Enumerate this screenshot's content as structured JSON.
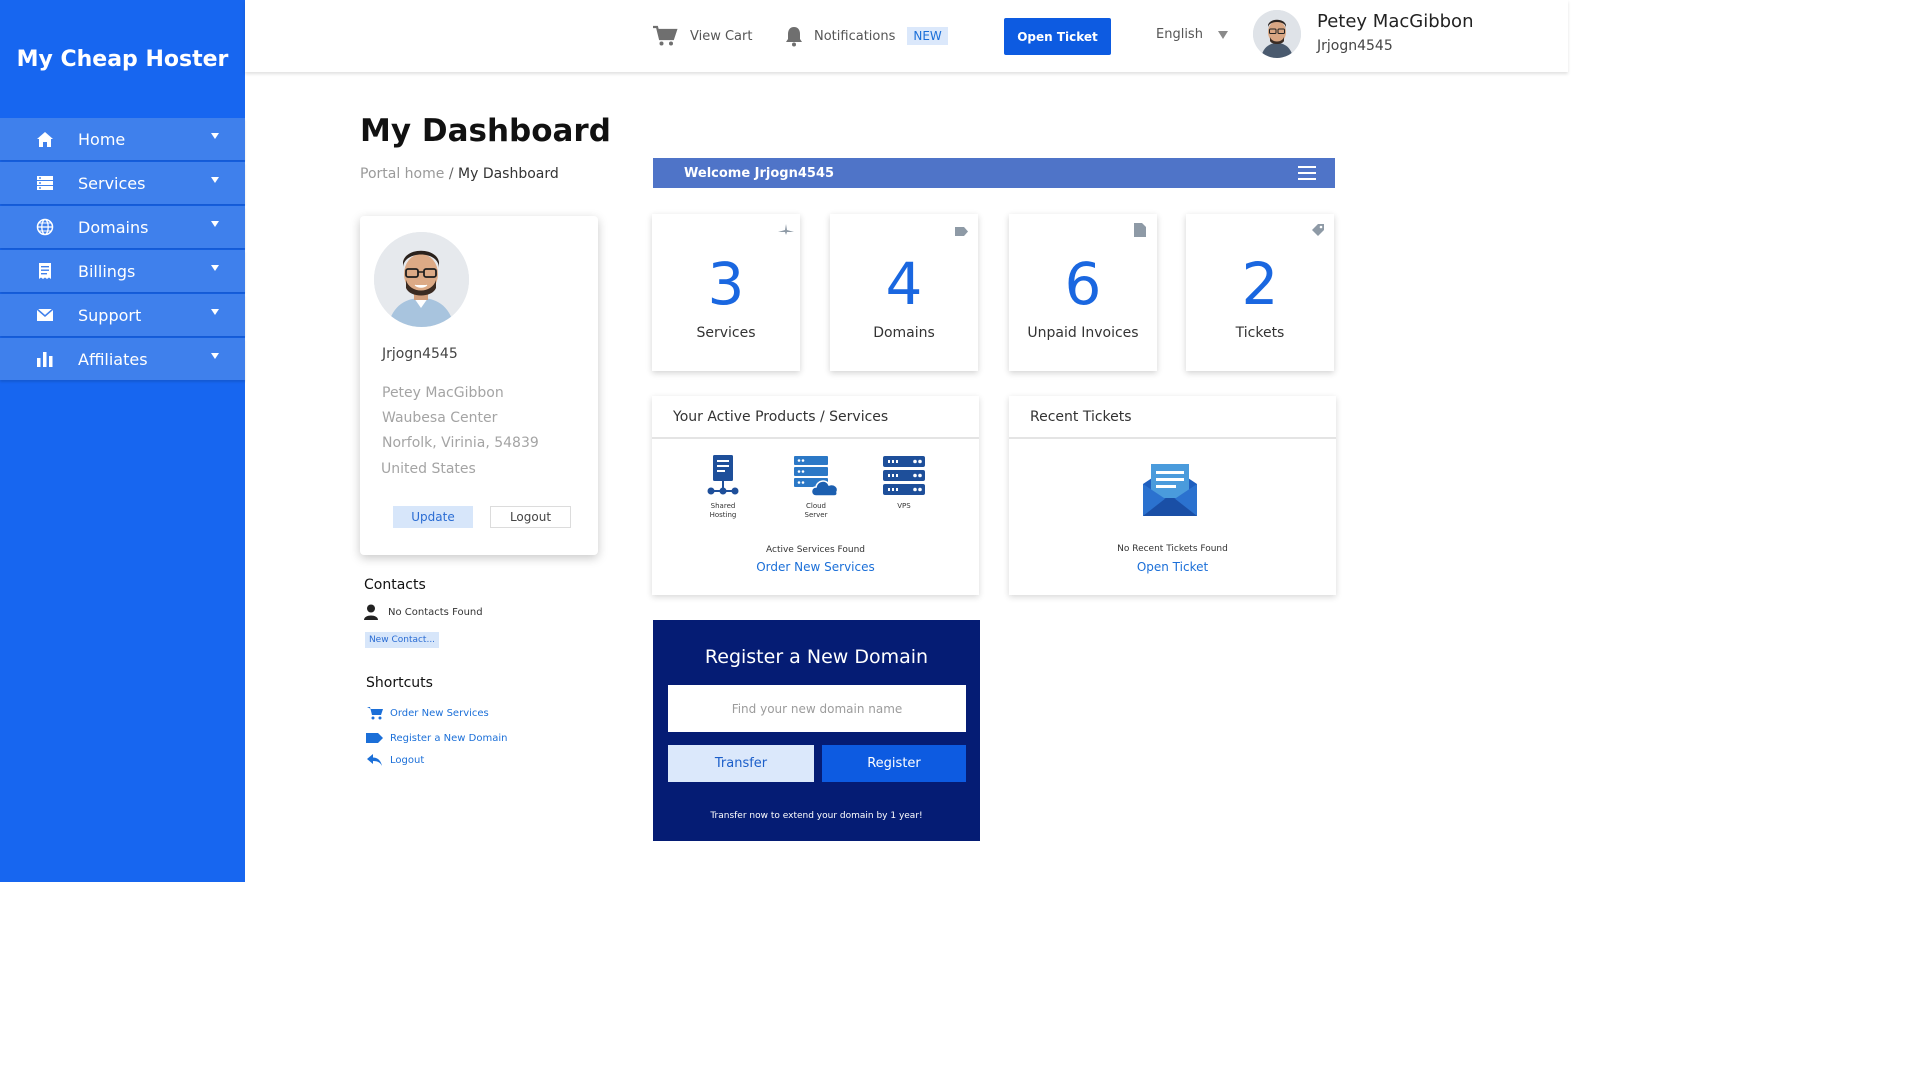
{
  "brand": "My Cheap Hoster",
  "sidebar": {
    "items": [
      {
        "label": "Home",
        "icon": "home-icon"
      },
      {
        "label": "Services",
        "icon": "server-icon"
      },
      {
        "label": "Domains",
        "icon": "globe-icon"
      },
      {
        "label": "Billings",
        "icon": "receipt-icon"
      },
      {
        "label": "Support",
        "icon": "envelope-icon"
      },
      {
        "label": "Affiliates",
        "icon": "bar-chart-icon"
      }
    ]
  },
  "topbar": {
    "cart_label": "View Cart",
    "notifications_label": "Notifications",
    "notifications_badge": "NEW",
    "open_ticket_label": "Open Ticket",
    "language": "English",
    "user_name": "Petey MacGibbon",
    "username": "Jrjogn4545"
  },
  "page": {
    "title": "My Dashboard",
    "breadcrumb_home": "Portal home",
    "breadcrumb_sep": " / ",
    "breadcrumb_current": "My Dashboard",
    "welcome": "Welcome Jrjogn4545"
  },
  "profile": {
    "username": "Jrjogn4545",
    "name": "Petey MacGibbon",
    "address1": "Waubesa Center",
    "address2": "Norfolk, Virinia, 54839",
    "country": "United States",
    "update_label": "Update",
    "logout_label": "Logout"
  },
  "contacts": {
    "title": "Contacts",
    "empty": "No Contacts Found",
    "new_label": "New Contact..."
  },
  "shortcuts": {
    "title": "Shortcuts",
    "items": [
      {
        "label": "Order New Services",
        "icon": "cart-icon"
      },
      {
        "label": "Register a New Domain",
        "icon": "tag-icon"
      },
      {
        "label": "Logout",
        "icon": "reply-icon"
      }
    ]
  },
  "stats": [
    {
      "value": "3",
      "label": "Services",
      "icon": "plane-icon"
    },
    {
      "value": "4",
      "label": "Domains",
      "icon": "tag-icon"
    },
    {
      "value": "6",
      "label": "Unpaid Invoices",
      "icon": "document-icon"
    },
    {
      "value": "2",
      "label": "Tickets",
      "icon": "ticket-icon"
    }
  ],
  "products_panel": {
    "title": "Your Active Products / Services",
    "services": [
      {
        "label_line1": "Shared",
        "label_line2": "Hosting",
        "icon": "shared-hosting-icon"
      },
      {
        "label_line1": "Cloud",
        "label_line2": "Server",
        "icon": "cloud-server-icon"
      },
      {
        "label_line1": "VPS",
        "label_line2": "",
        "icon": "vps-icon"
      }
    ],
    "note": "Active Services Found",
    "link": "Order New Services"
  },
  "tickets_panel": {
    "title": "Recent Tickets",
    "note": "No Recent Tickets Found",
    "link": "Open Ticket"
  },
  "domain_box": {
    "title": "Register a New Domain",
    "placeholder": "Find your new domain name",
    "transfer_label": "Transfer",
    "register_label": "Register",
    "note": "Transfer now to extend your domain by 1 year!"
  },
  "colors": {
    "sidebar": "#1766f0",
    "sidebar_item": "#3f80ec",
    "accent": "#0d5be1",
    "welcome_bar": "#4f74c8",
    "stat_number": "#1a67e0",
    "domain_box": "#051c74"
  }
}
